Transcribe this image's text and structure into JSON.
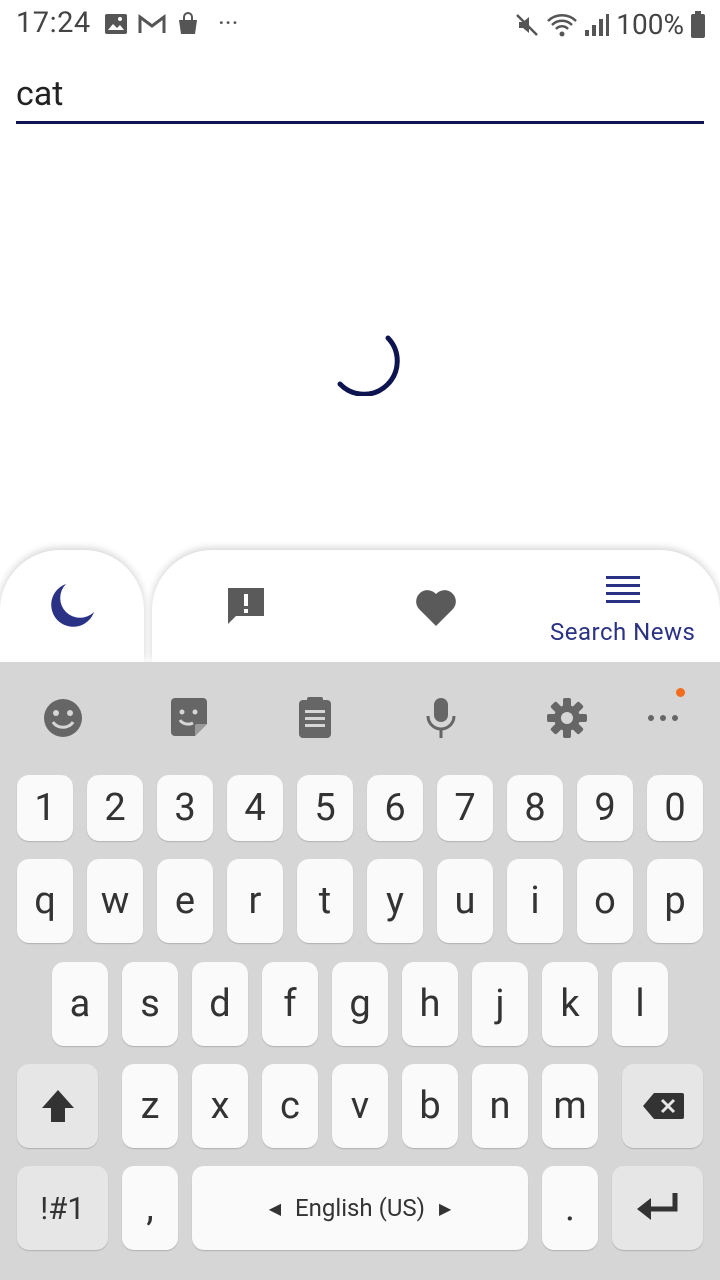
{
  "status_bar": {
    "time": "17:24",
    "more_indicator": "···",
    "battery_percent": "100%"
  },
  "search": {
    "value": "cat"
  },
  "nav": {
    "search_news_label": "Search News"
  },
  "keyboard": {
    "number_row": [
      "1",
      "2",
      "3",
      "4",
      "5",
      "6",
      "7",
      "8",
      "9",
      "0"
    ],
    "row1": [
      "q",
      "w",
      "e",
      "r",
      "t",
      "y",
      "u",
      "i",
      "o",
      "p"
    ],
    "row2": [
      "a",
      "s",
      "d",
      "f",
      "g",
      "h",
      "j",
      "k",
      "l"
    ],
    "row3": [
      "z",
      "x",
      "c",
      "v",
      "b",
      "n",
      "m"
    ],
    "symbols_label": "!#1",
    "comma": ",",
    "period": ".",
    "language": "English (US)"
  },
  "colors": {
    "accent": "#0d1450",
    "nav_active": "#2a3285",
    "keyboard_bg": "#d6d6d6"
  }
}
